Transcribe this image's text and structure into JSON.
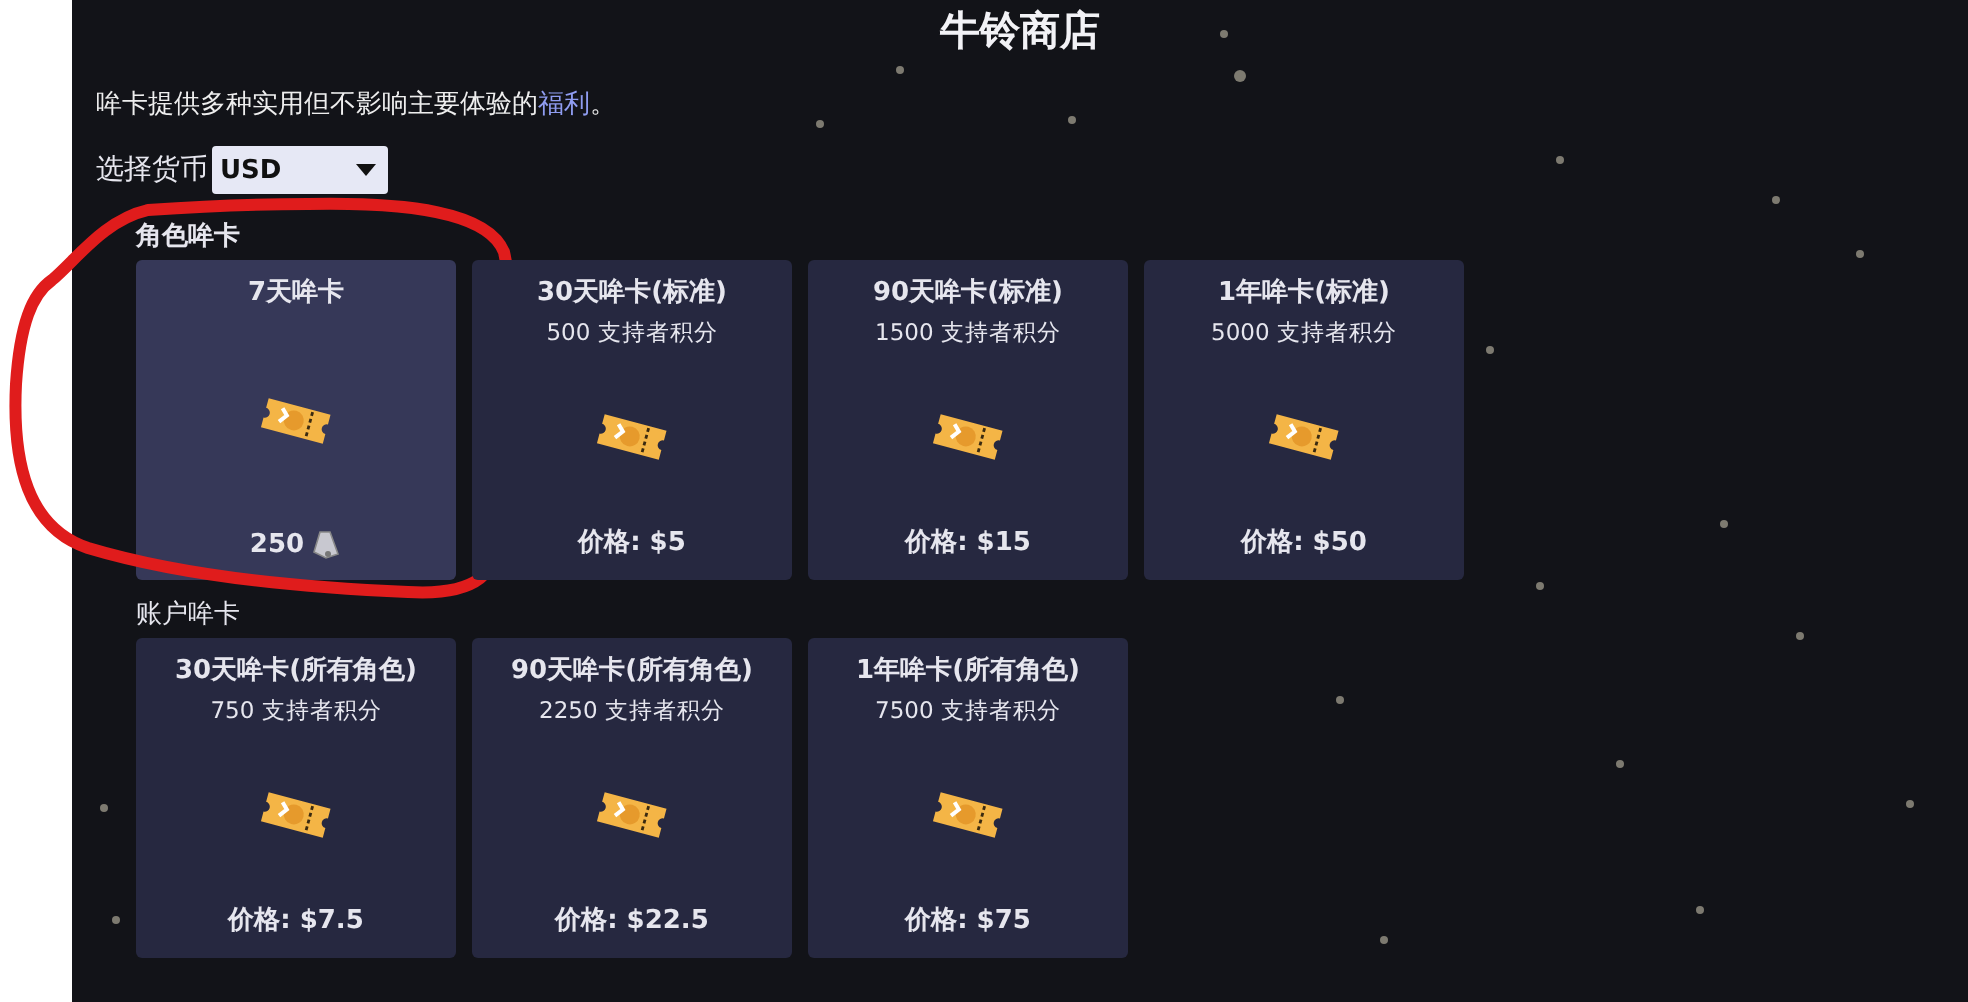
{
  "title": "牛铃商店",
  "intro": {
    "text": "哞卡提供多种实用但不影响主要体验的",
    "link": "福利",
    "end": "。"
  },
  "currency": {
    "label": "选择货币",
    "value": "USD"
  },
  "sections": [
    {
      "heading": "角色哞卡",
      "cards": [
        {
          "name": "7天哞卡",
          "price": "250",
          "kind": "bell",
          "highlighted": true,
          "marked": true
        },
        {
          "name": "30天哞卡(标准)",
          "points": "500 支持者积分",
          "price": "价格: $5",
          "kind": "text",
          "highlighted": false,
          "marked": false
        },
        {
          "name": "90天哞卡(标准)",
          "points": "1500 支持者积分",
          "price": "价格: $15",
          "kind": "text",
          "highlighted": false,
          "marked": false
        },
        {
          "name": "1年哞卡(标准)",
          "points": "5000 支持者积分",
          "price": "价格: $50",
          "kind": "text",
          "highlighted": false,
          "marked": false
        }
      ]
    },
    {
      "heading": "账户哞卡",
      "cards": [
        {
          "name": "30天哞卡(所有角色)",
          "points": "750 支持者积分",
          "price": "价格: $7.5",
          "kind": "text",
          "highlighted": false,
          "marked": false
        },
        {
          "name": "90天哞卡(所有角色)",
          "points": "2250 支持者积分",
          "price": "价格: $22.5",
          "kind": "text",
          "highlighted": false,
          "marked": false
        },
        {
          "name": "1年哞卡(所有角色)",
          "points": "7500 支持者积分",
          "price": "价格: $75",
          "kind": "text",
          "highlighted": false,
          "marked": false
        }
      ]
    }
  ]
}
